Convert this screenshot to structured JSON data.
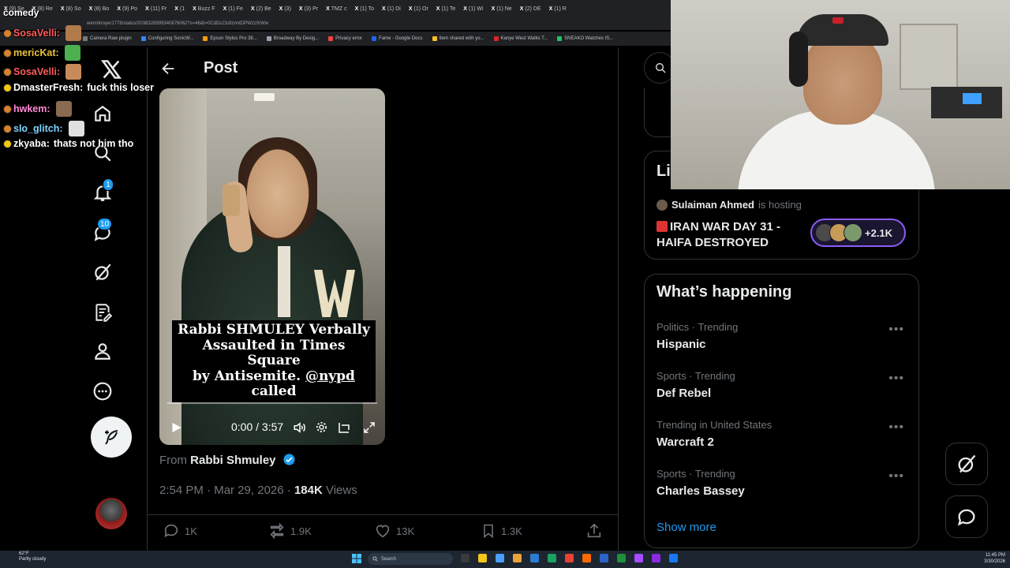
{
  "browser": {
    "tabs": [
      "(9) Se",
      "(8) Re",
      "(8) So",
      "(8) Bo",
      "(9) Po",
      "(11) Fr",
      "(1",
      "Buzz F",
      "(1) Fe",
      "(2) Be",
      "(3)",
      "(3) Pr",
      "TMZ c",
      "(1) To",
      "(1) Di",
      "(1) Or",
      "(1) Te",
      "(1) Wi",
      "(1) Ne",
      "(2) DE",
      "(1) R"
    ],
    "url": "wershtroyer1776/status/2038328999340876062?s=46&t=0CdDcCls9znntDPWzz0rWw",
    "bookmarks": [
      "Camera Raw plugin",
      "Configuring SonicW...",
      "Epson Stylus Pro 38...",
      "Broadway By Desig...",
      "Privacy error",
      "Fame - Google Docs",
      "Item shared with yo...",
      "Kanye West Walks T...",
      "SNEAKO Watches IS..."
    ]
  },
  "stream": {
    "label": "comedy"
  },
  "chat": [
    {
      "user": "SosaVelli:",
      "text": "",
      "color": "#ff5a5a"
    },
    {
      "user": "mericKat:",
      "text": "",
      "color": "#e8c23a"
    },
    {
      "user": "SosaVelli:",
      "text": "",
      "color": "#ff5a5a"
    },
    {
      "user": "DmasterFresh:",
      "text": "fuck this loser",
      "color": "#ffffff"
    },
    {
      "user": "hwkem:",
      "text": "",
      "color": "#ff8ad8"
    },
    {
      "user": "slo_glitch:",
      "text": "",
      "color": "#7fd3ff"
    },
    {
      "user": "zkyaba:",
      "text": "thats not him tho",
      "color": "#ffffff"
    }
  ],
  "nav": {
    "notifications_badge": "1",
    "messages_badge": "10"
  },
  "post": {
    "header_title": "Post",
    "video_caption_line1": "Rabbi SHMULEY Verbally",
    "video_caption_line2": "Assaulted in Times Square",
    "video_caption_line3a": "by Antisemite. ",
    "video_caption_mention": "@nypd",
    "video_caption_line3b": " called",
    "video_time": "0:00 / 3:57",
    "video_progress": 0.0,
    "from_prefix": "From ",
    "from_name": "Rabbi Shmuley",
    "time": "2:54 PM",
    "date": "Mar 29, 2026",
    "views_count": "184K",
    "views_label": " Views",
    "replies": "1K",
    "reposts": "1.9K",
    "likes": "13K",
    "bookmarks": "1.3K"
  },
  "live": {
    "title": "Li",
    "host_name": "Sulaiman Ahmed",
    "host_suffix": "is hosting",
    "space_title": "IRAN WAR DAY 31 - HAIFA DESTROYED",
    "listeners": "+2.1K"
  },
  "happening": {
    "title": "What’s happening",
    "trends": [
      {
        "category": "Politics · Trending",
        "name": "Hispanic"
      },
      {
        "category": "Sports · Trending",
        "name": "Def Rebel"
      },
      {
        "category": "Trending in United States",
        "name": "Warcraft 2"
      },
      {
        "category": "Sports · Trending",
        "name": "Charles Bassey"
      }
    ],
    "show_more": "Show more"
  },
  "taskbar": {
    "temperature": "62°F",
    "weather": "Partly cloudy",
    "search_placeholder": "Search",
    "time": "11:45 PM",
    "date": "3/30/2026"
  },
  "colors": {
    "accent": "#1d9bf0",
    "background": "#000000",
    "border": "#2f3336",
    "muted": "#71767b"
  }
}
